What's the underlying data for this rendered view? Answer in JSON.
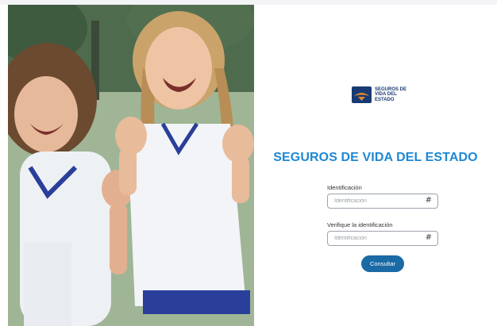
{
  "brand": {
    "logo_text": "SEGUROS DE VIDA DEL ESTADO",
    "title": "SEGUROS DE VIDA DEL ESTADO"
  },
  "form": {
    "field1": {
      "label": "Identificación",
      "placeholder": "Identificación",
      "icon": "#"
    },
    "field2": {
      "label": "Verifique la identificación",
      "placeholder": "Identificación",
      "icon": "#"
    },
    "submit_label": "Consultar"
  },
  "colors": {
    "title": "#1e88d4",
    "button": "#1a6aa6",
    "logo": "#173a72"
  }
}
